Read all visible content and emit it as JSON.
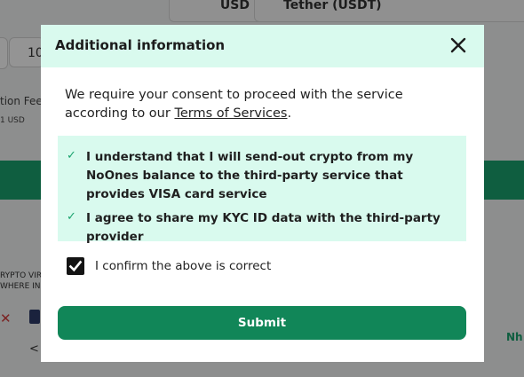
{
  "background": {
    "currency_field": "USD",
    "crypto_field": "Tether (USDT)",
    "amount_partial": "10",
    "fee_label_partial": "tion Fee",
    "fee_value_partial": "1 USD",
    "card_text_partial_line1": "RYPTO VIR",
    "card_text_partial_line2": "WHERE IN",
    "right_text_partial": "Nh"
  },
  "modal": {
    "title": "Additional information",
    "consent_text": "We require your consent to proceed with the service according to our ",
    "terms_link": "Terms of Services",
    "consent_suffix": ".",
    "terms": [
      {
        "check": "✓",
        "text": "I understand that I will send-out crypto from my NoOnes balance to the third-party service that provides VISA card service"
      },
      {
        "check": "✓",
        "text": "I agree to share my KYC ID data with the third-party provider"
      }
    ],
    "confirm_label": "I confirm the above is correct",
    "confirm_checked": true,
    "submit_label": "Submit"
  },
  "colors": {
    "accent": "#118658",
    "header_bg": "#d9faee",
    "check_green": "#1aa36e"
  },
  "icons": {
    "close": "close-icon",
    "checkbox": "checkmark-icon"
  }
}
